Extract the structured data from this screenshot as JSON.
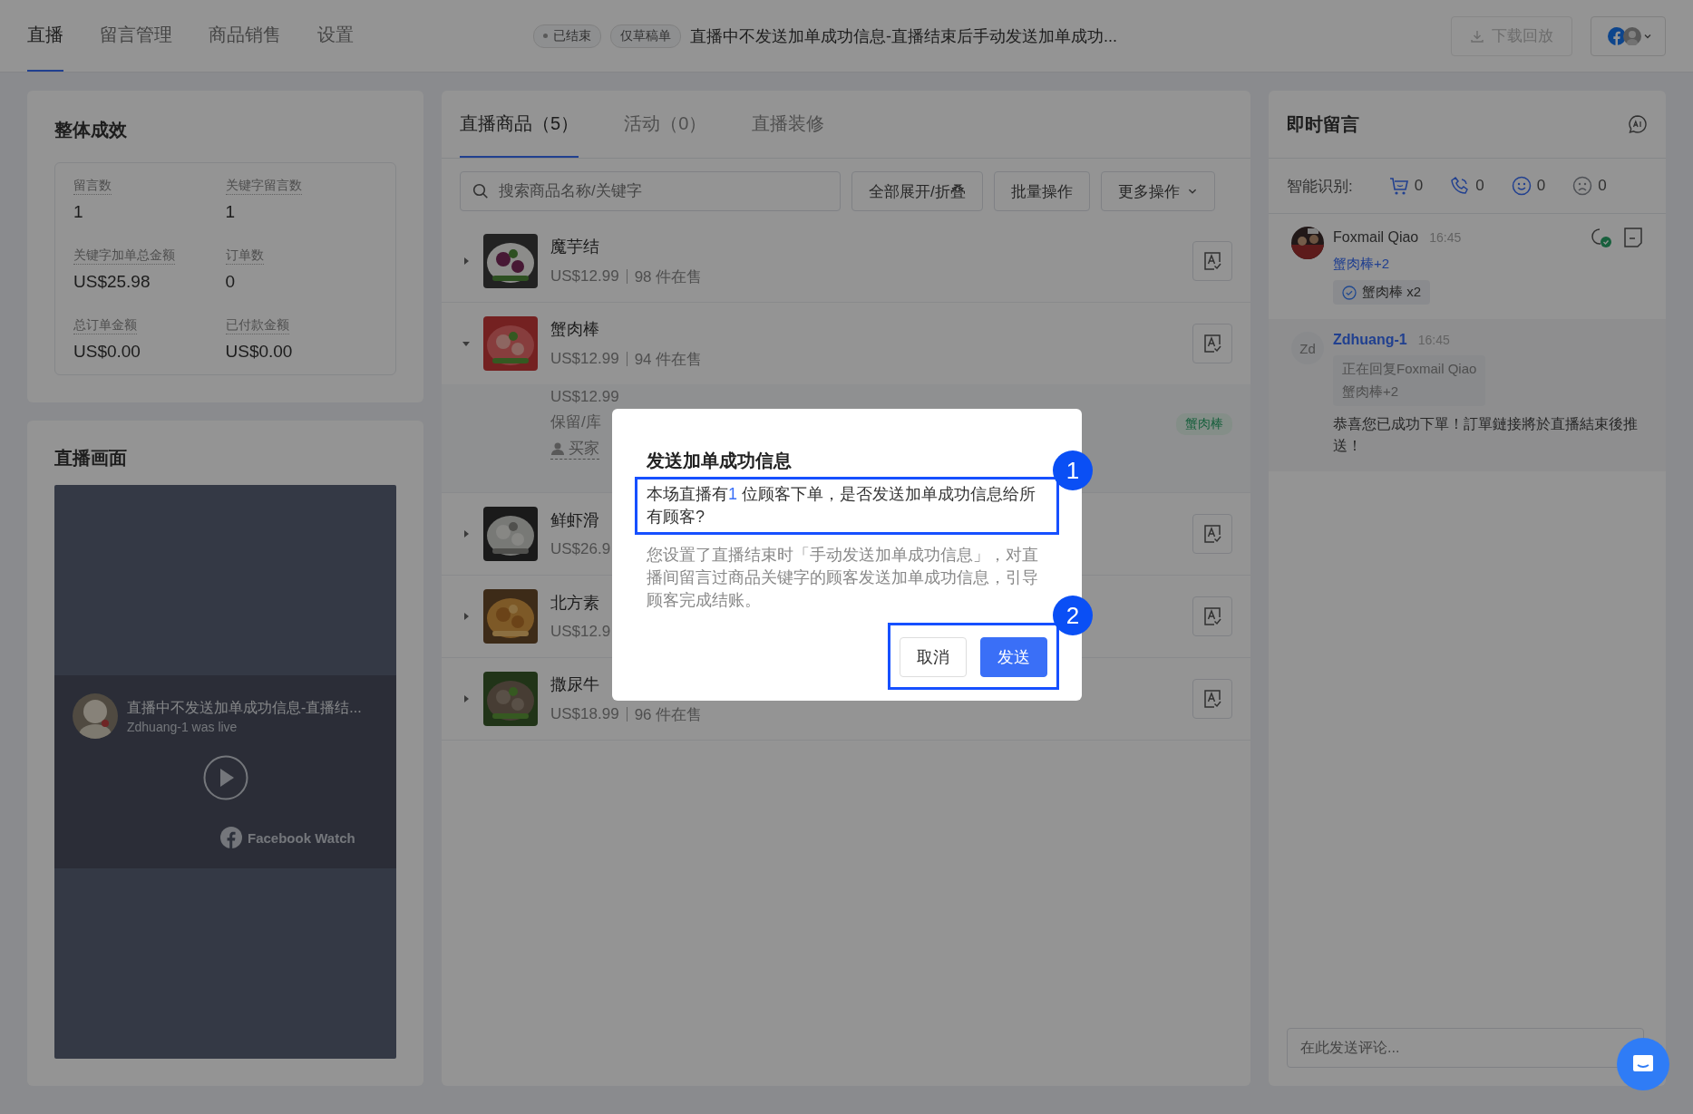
{
  "top_nav": {
    "tabs": [
      {
        "label": "直播",
        "selected": true
      },
      {
        "label": "留言管理",
        "selected": false
      },
      {
        "label": "商品销售",
        "selected": false
      },
      {
        "label": "设置",
        "selected": false
      }
    ],
    "status_tags": [
      {
        "label": "已结束",
        "kind": "dot"
      },
      {
        "label": "仅草稿单",
        "kind": "plain"
      }
    ],
    "live_title": "直播中不发送加单成功信息-直播结束后手动发送加单成功...",
    "download_button": {
      "label": "下载回放",
      "disabled": true
    }
  },
  "overview": {
    "title": "整体成效",
    "stats": [
      {
        "label": "留言数",
        "value": "1"
      },
      {
        "label": "关键字留言数",
        "value": "1"
      },
      {
        "label": "关键字加单总金额",
        "value": "US$25.98"
      },
      {
        "label": "订单数",
        "value": "0"
      },
      {
        "label": "总订单金额",
        "value": "US$0.00"
      },
      {
        "label": "已付款金额",
        "value": "US$0.00"
      }
    ]
  },
  "video_panel": {
    "title": "直播画面",
    "embed": {
      "title": "直播中不发送加单成功信息-直播结...",
      "subtitle": "Zdhuang-1 was live",
      "brand": "Facebook Watch"
    }
  },
  "products_panel": {
    "tabs": [
      {
        "label": "直播商品（5）",
        "selected": true
      },
      {
        "label": "活动（0）",
        "selected": false
      },
      {
        "label": "直播装修",
        "selected": false
      }
    ],
    "search": {
      "placeholder": "搜索商品名称/关键字"
    },
    "buttons": [
      {
        "label": "全部展开/折叠",
        "kind": "plain"
      },
      {
        "label": "批量操作",
        "kind": "plain"
      },
      {
        "label": "更多操作",
        "kind": "dropdown"
      }
    ],
    "items": [
      {
        "name": "魔芋结",
        "price": "US$12.99",
        "stock": "98 件在售",
        "expanded": false
      },
      {
        "name": "蟹肉棒",
        "price": "US$12.99",
        "stock": "94 件在售",
        "expanded": true,
        "detail": {
          "price": "US$12.99",
          "stock_label": "保留/库",
          "buyer": "买家",
          "tag": "蟹肉棒"
        }
      },
      {
        "name": "鲜虾滑",
        "price": "US$26.9",
        "expanded": false
      },
      {
        "name": "北方素",
        "price": "US$12.9",
        "expanded": false
      },
      {
        "name": "撒尿牛",
        "price": "US$18.99",
        "stock": "96 件在售",
        "expanded": false
      }
    ]
  },
  "comments_panel": {
    "title": "即时留言",
    "recognition": {
      "label": "智能识别:",
      "counters": [
        {
          "kind": "cart",
          "count": "0"
        },
        {
          "kind": "phone",
          "count": "0"
        },
        {
          "kind": "smile",
          "count": "0"
        },
        {
          "kind": "sad",
          "count": "0"
        }
      ]
    },
    "comments": [
      {
        "kind": "customer",
        "author": "Foxmail Qiao",
        "time": "16:45",
        "keyword": "蟹肉棒+2",
        "order": "蟹肉棒 x2"
      },
      {
        "kind": "reply",
        "author": "Zdhuang-1",
        "avatar_text": "Zd",
        "time": "16:45",
        "quote": [
          "正在回复Foxmail Qiao",
          "蟹肉棒+2"
        ],
        "text": "恭喜您已成功下單！訂單鏈接將於直播結束後推送！"
      }
    ],
    "input": {
      "placeholder": "在此发送评论..."
    }
  },
  "modal": {
    "title": "发送加单成功信息",
    "question": {
      "before": "本场直播有",
      "count": "1",
      "after": " 位顾客下单，是否发送加单成功信息给所有顾客?"
    },
    "description": "您设置了直播结束时「手动发送加单成功信息」，对直播间留言过商品关键字的顾客发送加单成功信息，引导顾客完成结账。",
    "buttons": [
      {
        "label": "取消",
        "kind": "secondary"
      },
      {
        "label": "发送",
        "kind": "primary"
      }
    ],
    "callouts": [
      "1",
      "2"
    ]
  }
}
